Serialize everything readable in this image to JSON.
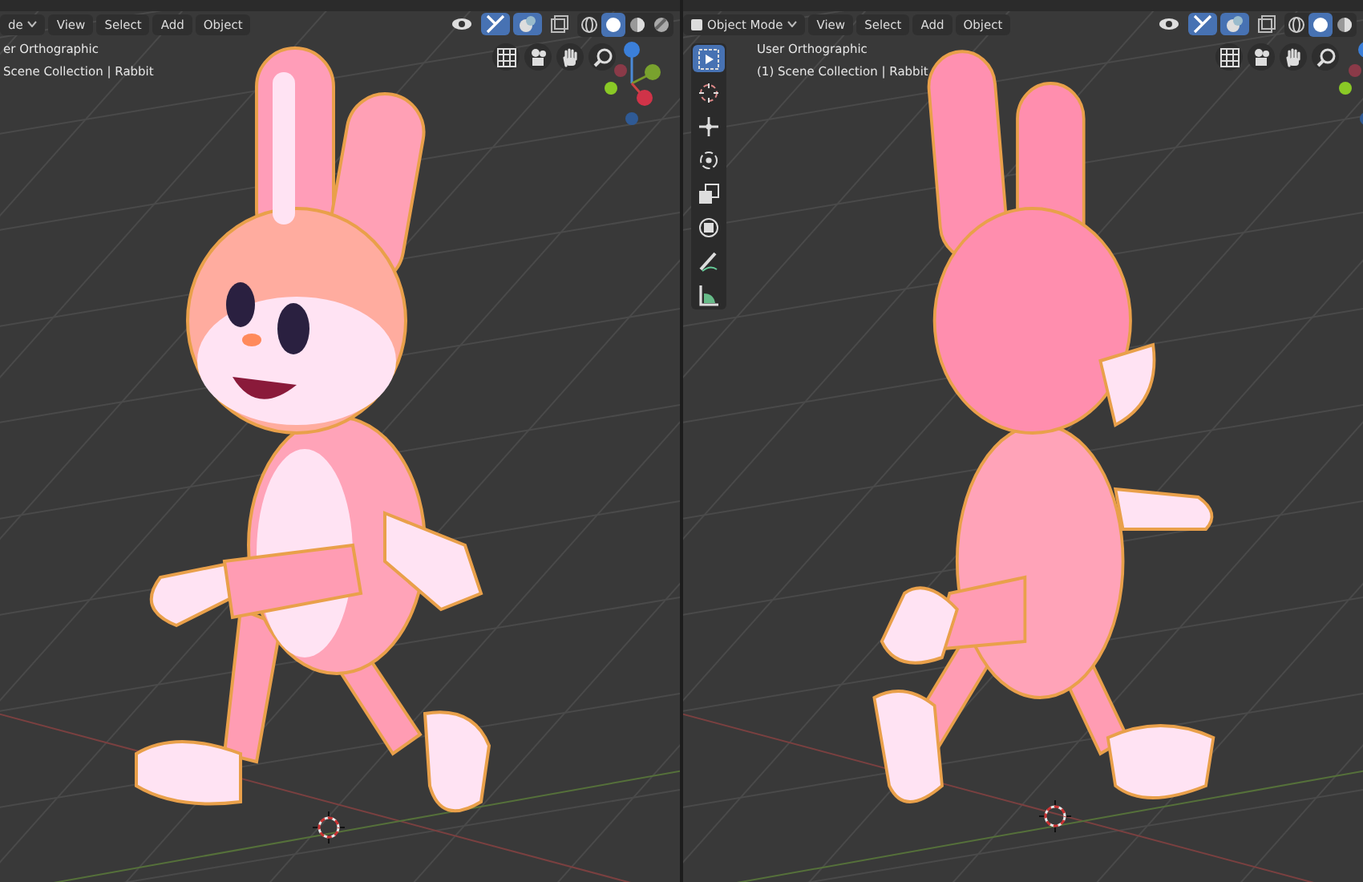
{
  "viewports": [
    {
      "mode": {
        "label": "de",
        "icon": false
      },
      "menus": [
        "View",
        "Select",
        "Add",
        "Object"
      ],
      "view_name": "er Orthographic",
      "collection": "Scene Collection | Rabbit",
      "shading": [
        {
          "kind": "wireframe",
          "selected": false
        },
        {
          "kind": "solid",
          "selected": true
        },
        {
          "kind": "material",
          "selected": false
        },
        {
          "kind": "rendered",
          "selected": false
        }
      ],
      "model": {
        "kind": "front"
      }
    },
    {
      "mode": {
        "label": "Object Mode",
        "icon": true
      },
      "menus": [
        "View",
        "Select",
        "Add",
        "Object"
      ],
      "view_name": "User Orthographic",
      "collection": "(1) Scene Collection | Rabbit",
      "tools": [
        {
          "kind": "select",
          "selected": true
        },
        {
          "kind": "cursor",
          "selected": false
        },
        {
          "kind": "move",
          "selected": false
        },
        {
          "kind": "rotate",
          "selected": false
        },
        {
          "kind": "scale",
          "selected": false
        },
        {
          "kind": "transform",
          "selected": false
        },
        {
          "kind": "annotate",
          "selected": false
        },
        {
          "kind": "measure",
          "selected": false
        }
      ],
      "shading": [
        {
          "kind": "wireframe",
          "selected": false
        },
        {
          "kind": "solid",
          "selected": true
        },
        {
          "kind": "material",
          "selected": false
        }
      ],
      "model": {
        "kind": "back"
      }
    }
  ]
}
